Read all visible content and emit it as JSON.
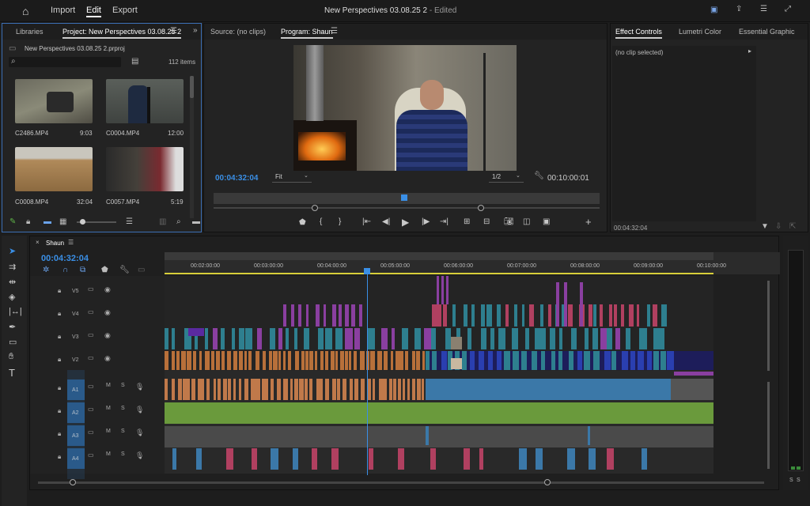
{
  "topbar": {
    "title": "New Perspectives 03.08.25 2",
    "edited": "- Edited",
    "modes": [
      "Import",
      "Edit",
      "Export"
    ]
  },
  "project": {
    "tabs": [
      "Libraries",
      "Project: New Perspectives 03.08.25 2"
    ],
    "file": "New Perspectives 03.08.25 2.prproj",
    "items_count": "112 items",
    "clips": [
      {
        "name": "C2486.MP4",
        "duration": "9:03"
      },
      {
        "name": "C0004.MP4",
        "duration": "12:00"
      },
      {
        "name": "C0008.MP4",
        "duration": "32:04"
      },
      {
        "name": "C0057.MP4",
        "duration": "5:19"
      }
    ]
  },
  "monitor": {
    "source_tab": "Source: (no clips)",
    "program_tab": "Program: Shaun",
    "timecode": "00:04:32:04",
    "fit": "Fit",
    "resolution": "1/2",
    "duration": "00:10:00:01"
  },
  "effects": {
    "tabs": [
      "Effect Controls",
      "Lumetri Color",
      "Essential Graphic"
    ],
    "no_clip": "(no clip selected)",
    "timecode": "00:04:32:04"
  },
  "timeline": {
    "sequence": "Shaun",
    "timecode": "00:04:32:04",
    "ruler": [
      "00:02:00:00",
      "00:03:00:00",
      "00:04:00:00",
      "00:05:00:00",
      "00:06:00:00",
      "00:07:00:00",
      "00:08:00:00",
      "00:09:00:00",
      "00:10:00:00"
    ],
    "video_tracks": [
      "V5",
      "V4",
      "V3",
      "V2"
    ],
    "audio_tracks": [
      "A1",
      "A2",
      "A3",
      "A4"
    ],
    "track_letters": {
      "mute": "M",
      "solo": "S"
    }
  },
  "meter": {
    "labels": [
      "S",
      "S"
    ]
  },
  "colors": {
    "accent": "#3a8fe6",
    "teal": "#2e7f8f",
    "orange": "#b8703a",
    "purple": "#8a3fa0",
    "green": "#6a9a3c",
    "blue": "#2a3fb0",
    "pink": "#b04060"
  }
}
